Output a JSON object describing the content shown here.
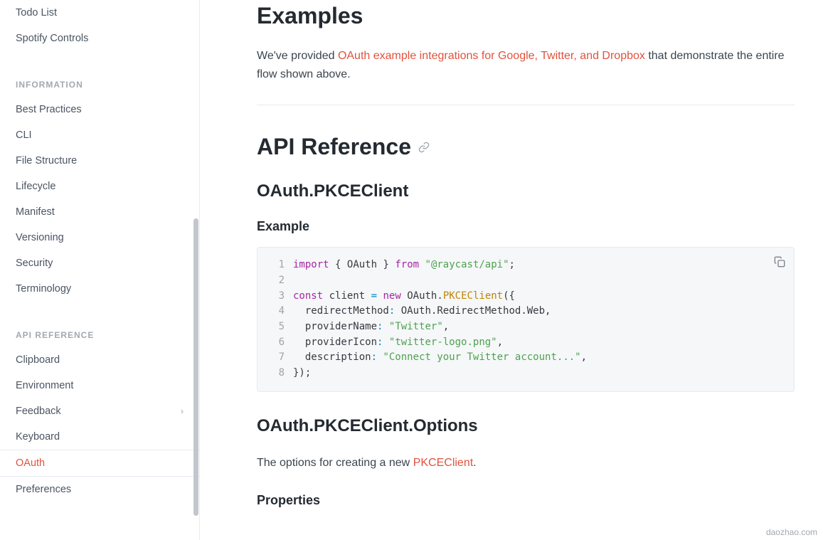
{
  "sidebar": {
    "top_items": [
      {
        "label": "Todo List"
      },
      {
        "label": "Spotify Controls"
      }
    ],
    "sections": [
      {
        "title": "INFORMATION",
        "items": [
          {
            "label": "Best Practices"
          },
          {
            "label": "CLI"
          },
          {
            "label": "File Structure"
          },
          {
            "label": "Lifecycle"
          },
          {
            "label": "Manifest"
          },
          {
            "label": "Versioning"
          },
          {
            "label": "Security"
          },
          {
            "label": "Terminology"
          }
        ]
      },
      {
        "title": "API REFERENCE",
        "items": [
          {
            "label": "Clipboard"
          },
          {
            "label": "Environment"
          },
          {
            "label": "Feedback",
            "expandable": true
          },
          {
            "label": "Keyboard"
          },
          {
            "label": "OAuth",
            "active": true
          },
          {
            "label": "Preferences"
          }
        ]
      }
    ]
  },
  "main": {
    "examples_heading": "Examples",
    "examples_para_pre": "We've provided ",
    "examples_link": "OAuth example integrations for Google, Twitter, and Dropbox",
    "examples_para_post": " that demonstrate the entire flow shown above.",
    "api_ref_heading": "API Reference",
    "pkce_heading": "OAuth.PKCEClient",
    "example_heading": "Example",
    "code": {
      "l1_import": "import",
      "l1_brace_open": "{",
      "l1_oauth": "OAuth",
      "l1_brace_close": "}",
      "l1_from": "from",
      "l1_pkg": "\"@raycast/api\"",
      "l1_semi": ";",
      "l3_const": "const",
      "l3_client": "client",
      "l3_eq": "=",
      "l3_new": "new",
      "l3_oauth": "OAuth",
      "l3_dot": ".",
      "l3_pkce": "PKCEClient",
      "l3_tail": "({",
      "l4_key": "redirectMethod",
      "l4_colon": ":",
      "l4_val": " OAuth.RedirectMethod.Web",
      "l4_comma": ",",
      "l5_key": "providerName",
      "l5_colon": ":",
      "l5_val": "\"Twitter\"",
      "l5_comma": ",",
      "l6_key": "providerIcon",
      "l6_colon": ":",
      "l6_val": "\"twitter-logo.png\"",
      "l6_comma": ",",
      "l7_key": "description",
      "l7_colon": ":",
      "l7_val": "\"Connect your Twitter account...\"",
      "l7_comma": ",",
      "l8": "});"
    },
    "options_heading": "OAuth.PKCEClient.Options",
    "options_para_pre": "The options for creating a new ",
    "options_link": "PKCEClient",
    "options_para_post": ".",
    "properties_heading": "Properties"
  },
  "watermark": "daozhao.com"
}
